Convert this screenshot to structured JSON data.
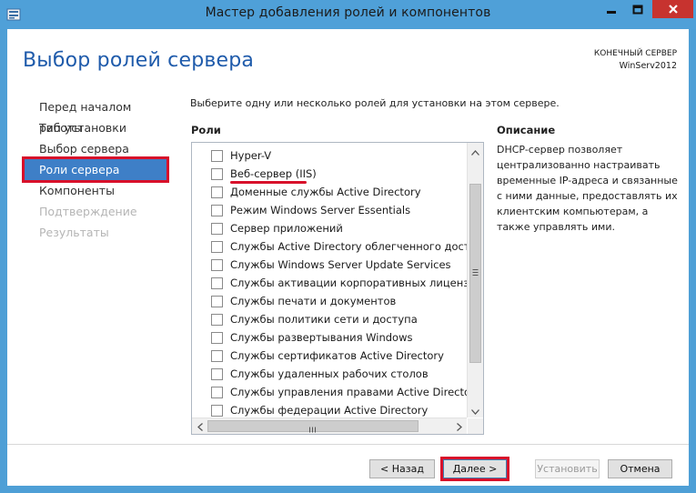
{
  "window": {
    "title": "Мастер добавления ролей и компонентов",
    "icons": {
      "app": "server-manager-icon",
      "minimize": "minimize-icon",
      "maximize": "maximize-icon",
      "close": "close-icon"
    }
  },
  "header": {
    "page_title": "Выбор ролей сервера",
    "destination_label": "КОНЕЧНЫЙ СЕРВЕР",
    "destination_server": "WinServ2012"
  },
  "nav": {
    "items": [
      {
        "label": "Перед началом работы",
        "state": "normal"
      },
      {
        "label": "Тип установки",
        "state": "normal"
      },
      {
        "label": "Выбор сервера",
        "state": "normal"
      },
      {
        "label": "Роли сервера",
        "state": "active"
      },
      {
        "label": "Компоненты",
        "state": "normal"
      },
      {
        "label": "Подтверждение",
        "state": "disabled"
      },
      {
        "label": "Результаты",
        "state": "disabled"
      }
    ]
  },
  "main": {
    "instruction": "Выберите одну или несколько ролей для установки на этом сервере.",
    "roles_heading": "Роли",
    "roles": [
      {
        "label": "Hyper-V",
        "checked": false
      },
      {
        "label": "Веб-сервер (IIS)",
        "checked": false
      },
      {
        "label": "Доменные службы Active Directory",
        "checked": false
      },
      {
        "label": "Режим Windows Server Essentials",
        "checked": false
      },
      {
        "label": "Сервер приложений",
        "checked": false
      },
      {
        "label": "Службы Active Directory облегченного доступа к",
        "checked": false
      },
      {
        "label": "Службы Windows Server Update Services",
        "checked": false
      },
      {
        "label": "Службы активации корпоративных лицензий",
        "checked": false
      },
      {
        "label": "Службы печати и документов",
        "checked": false
      },
      {
        "label": "Службы политики сети и доступа",
        "checked": false
      },
      {
        "label": "Службы развертывания Windows",
        "checked": false
      },
      {
        "label": "Службы сертификатов Active Directory",
        "checked": false
      },
      {
        "label": "Службы удаленных рабочих столов",
        "checked": false
      },
      {
        "label": "Службы управления правами Active Directory",
        "checked": false
      },
      {
        "label": "Службы федерации Active Directory",
        "checked": false
      }
    ],
    "description_heading": "Описание",
    "description": "DHCP-сервер позволяет централизованно настраивать временные IP-адреса и связанные с ними данные, предоставлять их клиентским компьютерам, а также управлять ими."
  },
  "footer": {
    "back_label": "< Назад",
    "next_label": "Далее >",
    "install_label": "Установить",
    "cancel_label": "Отмена"
  },
  "colors": {
    "title_bar": "#4fa0d8",
    "page_title": "#1f5bab",
    "nav_active": "#3e7fc7",
    "highlight": "#d8102a",
    "close_button": "#c7332f"
  }
}
